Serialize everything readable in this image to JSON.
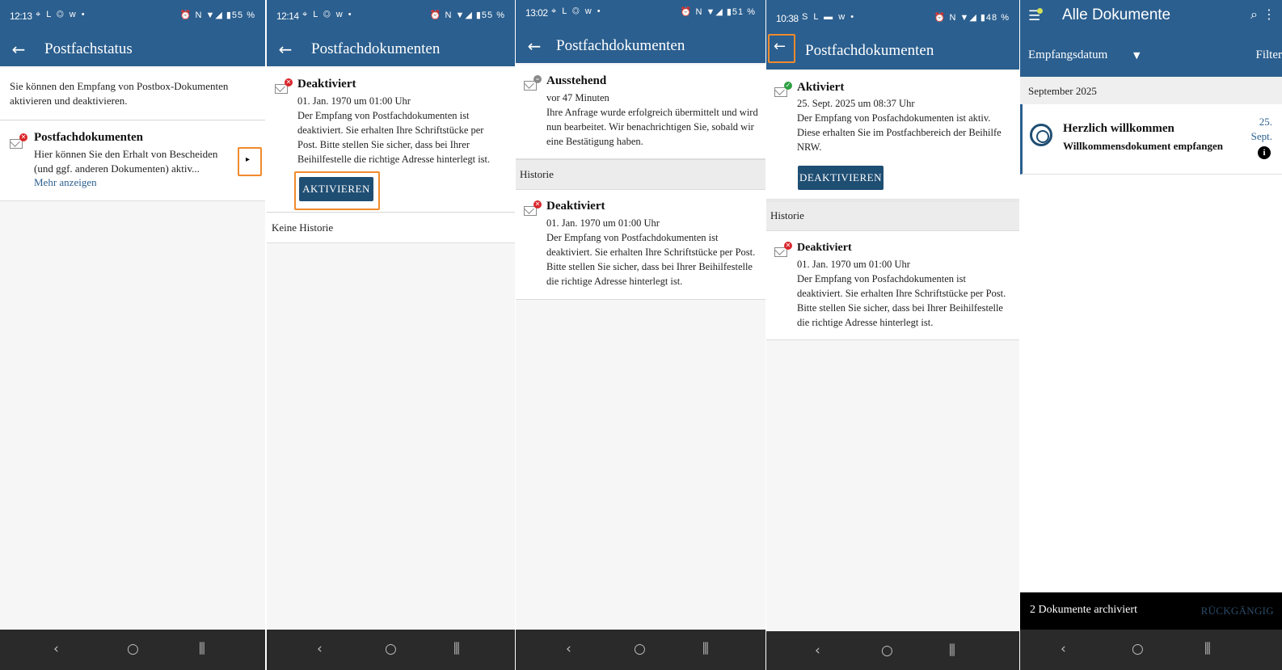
{
  "panel1": {
    "time": "12:13",
    "status_left": "⌖ L ◎ w •",
    "status_right": "⏰ N ▼◢ ▮55 %",
    "title": "Postfachstatus",
    "intro": "Sie können den Empfang von Postbox-Dokumenten aktivieren und deaktivieren.",
    "item_title": "Postfachdokumenten",
    "item_desc": "Hier können Sie den Erhalt von Bescheiden (und ggf. anderen Dokumenten) aktiv...",
    "more": "Mehr anzeigen"
  },
  "panel2": {
    "time": "12:14",
    "status_left": "⌖ L ◎ w •",
    "status_right": "⏰ N ▼◢ ▮55 %",
    "title": "Postfachdokumenten",
    "status": "Deaktiviert",
    "date": "01. Jan. 1970 um 01:00 Uhr",
    "desc": "Der Empfang von Postfachdokumenten ist deaktiviert. Sie erhalten Ihre Schriftstücke per Post. Bitte stellen Sie sicher, dass bei Ihrer Beihilfestelle die richtige Adresse hinterlegt ist.",
    "button": "AKTIVIEREN",
    "history": "Keine Historie"
  },
  "panel3": {
    "time": "13:02",
    "status_left": "⌖ L ◎ w •",
    "status_right": "⏰ N ▼◢ ▮51 %",
    "title": "Postfachdokumenten",
    "status": "Ausstehend",
    "date": "vor 47 Minuten",
    "desc": "Ihre Anfrage wurde erfolgreich übermittelt und wird nun bearbeitet. Wir benachrichtigen Sie, sobald wir eine Bestätigung haben.",
    "history_label": "Historie",
    "hist_status": "Deaktiviert",
    "hist_date": "01. Jan. 1970 um 01:00 Uhr",
    "hist_desc": "Der Empfang von Postfachdokumenten ist deaktiviert. Sie erhalten Ihre Schriftstücke per Post. Bitte stellen Sie sicher, dass bei Ihrer Beihilfestelle die richtige Adresse hinterlegt ist."
  },
  "panel4": {
    "time": "10:38",
    "status_left": "S L ▬ w •",
    "status_right": "⏰ N ▼◢ ▮48 %",
    "title": "Postfachdokumenten",
    "status": "Aktiviert",
    "date": "25. Sept. 2025 um 08:37 Uhr",
    "desc": "Der Empfang von Posfachdokumenten ist aktiv. Diese erhalten Sie im Postfachbereich der Beihilfe NRW.",
    "button": "DEAKTIVIEREN",
    "history_label": "Historie",
    "hist_status": "Deaktiviert",
    "hist_date": "01. Jan. 1970 um 01:00 Uhr",
    "hist_desc": "Der Empfang von Posfachdokumenten ist deaktiviert. Sie erhalten Ihre Schriftstücke per Post. Bitte stellen Sie sicher, dass bei Ihrer Beihilfestelle die richtige Adresse hinterlegt ist."
  },
  "panel5": {
    "title": "Alle Dokumente",
    "sort_label": "Empfangsdatum",
    "filter": "Filter",
    "month": "September 2025",
    "doc_title": "Herzlich willkommen",
    "doc_sub": "Willkommensdokument empfangen",
    "doc_day": "25.",
    "doc_month": "Sept.",
    "snackbar_msg": "2 Dokumente archiviert",
    "snackbar_undo": "RÜCKGÄNGIG"
  },
  "colors": {
    "primary": "#2b5f8f",
    "button": "#1f4e73",
    "highlight": "#f08a2c",
    "error": "#d9262b",
    "success": "#2ea043"
  }
}
